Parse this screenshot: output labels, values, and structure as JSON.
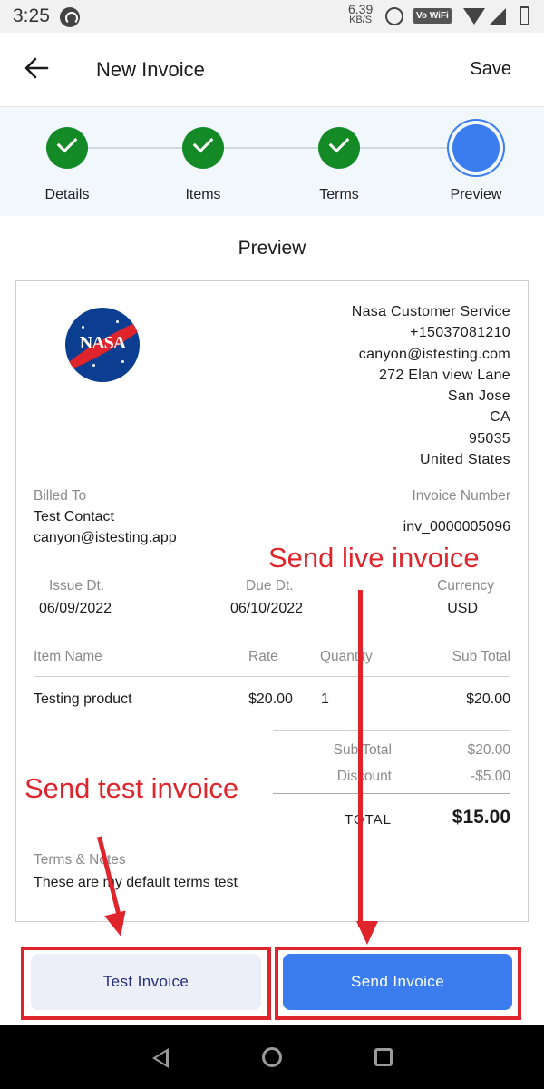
{
  "status_bar": {
    "time": "3:25",
    "speed_value": "6.39",
    "speed_unit": "KB/S",
    "volte": "Vo WiFi"
  },
  "appbar": {
    "title": "New Invoice",
    "save_label": "Save"
  },
  "stepper": {
    "steps": [
      {
        "label": "Details",
        "state": "done"
      },
      {
        "label": "Items",
        "state": "done"
      },
      {
        "label": "Terms",
        "state": "done"
      },
      {
        "label": "Preview",
        "state": "current"
      }
    ]
  },
  "heading": "Preview",
  "invoice": {
    "logo_text": "NASA",
    "company": {
      "name": "Nasa Customer Service",
      "phone": "+15037081210",
      "email": "canyon@istesting.com",
      "street": "272 Elan view Lane",
      "city": "San Jose",
      "state": "CA",
      "zip": "95035",
      "country": "United States"
    },
    "billed_to_label": "Billed To",
    "billed_to_name": "Test Contact",
    "billed_to_email": "canyon@istesting.app",
    "invoice_number_label": "Invoice Number",
    "invoice_number": "inv_0000005096",
    "issue_label": "Issue Dt.",
    "issue_date": "06/09/2022",
    "due_label": "Due Dt.",
    "due_date": "06/10/2022",
    "currency_label": "Currency",
    "currency": "USD",
    "table": {
      "headers": [
        "Item Name",
        "Rate",
        "Quantity",
        "Sub Total"
      ],
      "rows": [
        {
          "name": "Testing product",
          "rate": "$20.00",
          "qty": "1",
          "subtotal": "$20.00"
        }
      ]
    },
    "summary": {
      "subtotal_label": "Sub Total",
      "subtotal": "$20.00",
      "discount_label": "Discount",
      "discount": "-$5.00",
      "total_label": "TOTAL",
      "total": "$15.00"
    },
    "terms_label": "Terms & Notes",
    "terms_text": "These are my default terms test"
  },
  "buttons": {
    "test_label": "Test Invoice",
    "send_label": "Send Invoice"
  },
  "annotations": {
    "live": "Send live invoice",
    "test": "Send test invoice"
  },
  "colors": {
    "primary": "#3b7dee",
    "done_green": "#148a26",
    "annotation_red": "#e0242c",
    "secondary_btn_bg": "#eceef8"
  }
}
